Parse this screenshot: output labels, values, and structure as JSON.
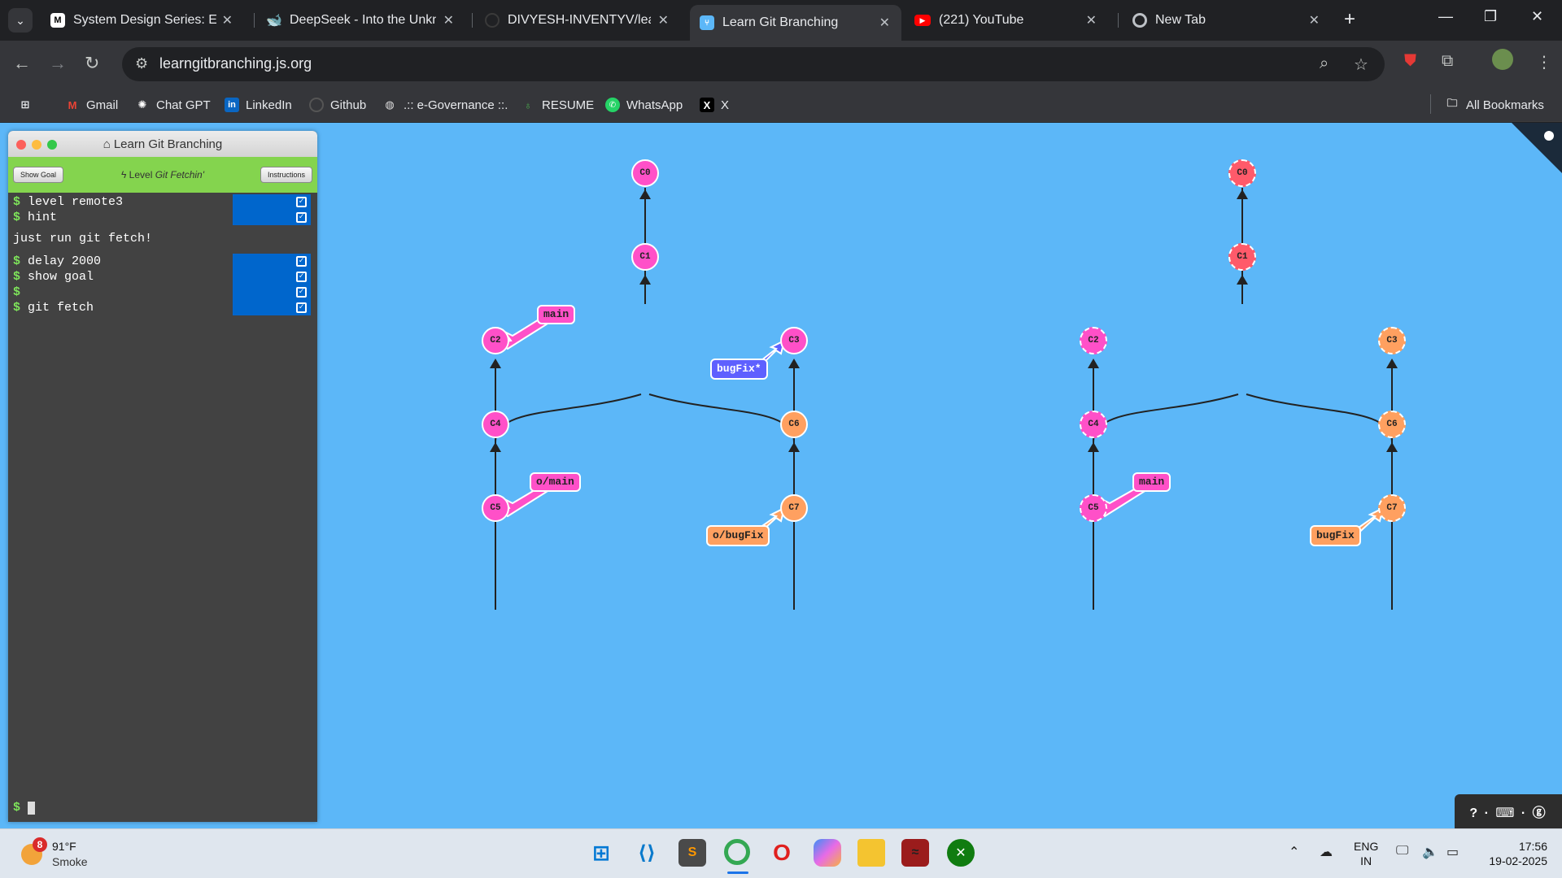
{
  "tabs": [
    {
      "favicon": "medium-icon",
      "title": "System Design Series: Elasti"
    },
    {
      "favicon": "deepseek-icon",
      "title": "DeepSeek - Into the Unkno"
    },
    {
      "favicon": "github-icon",
      "title": "DIVYESH-INVENTYV/learn-"
    },
    {
      "favicon": "learngit-icon",
      "title": "Learn Git Branching"
    },
    {
      "favicon": "youtube-icon",
      "title": "(221) YouTube"
    },
    {
      "favicon": "chrome-icon",
      "title": "New Tab"
    }
  ],
  "active_tab": 3,
  "address_bar": {
    "url": "learngitbranching.js.org"
  },
  "bookmarks": [
    {
      "icon": "apps-grid-icon",
      "label": ""
    },
    {
      "icon": "gmail-icon",
      "label": "Gmail"
    },
    {
      "icon": "chatgpt-icon",
      "label": "Chat GPT"
    },
    {
      "icon": "linkedin-icon",
      "label": "LinkedIn"
    },
    {
      "icon": "github-icon",
      "label": "Github"
    },
    {
      "icon": "globe-icon",
      "label": ".:: e-Governance ::."
    },
    {
      "icon": "resume-icon",
      "label": "RESUME"
    },
    {
      "icon": "whatsapp-icon",
      "label": "WhatsApp"
    },
    {
      "icon": "x-icon",
      "label": "X"
    }
  ],
  "all_bookmarks_label": "All Bookmarks",
  "terminal": {
    "title": "Learn Git Branching",
    "show_goal": "Show Goal",
    "level_prefix": "Level",
    "level_name": "Git Fetchin'",
    "instructions": "Instructions",
    "commands": [
      {
        "text": "level remote3"
      },
      {
        "text": "hint"
      },
      {
        "text": "delay 2000"
      },
      {
        "text": "show goal"
      },
      {
        "text": ""
      },
      {
        "text": "git fetch"
      }
    ],
    "hint_output": "just run git fetch!",
    "prompt": "$"
  },
  "trees": {
    "left": {
      "commits": [
        "C0",
        "C1",
        "C2",
        "C4",
        "C5",
        "C3",
        "C6",
        "C7"
      ],
      "branches": [
        {
          "name": "main",
          "target": "C2"
        },
        {
          "name": "bugFix*",
          "target": "C3"
        },
        {
          "name": "o/main",
          "target": "C5"
        },
        {
          "name": "o/bugFix",
          "target": "C7"
        }
      ]
    },
    "right": {
      "commits": [
        "C0",
        "C1",
        "C2",
        "C4",
        "C5",
        "C3",
        "C6",
        "C7"
      ],
      "branches": [
        {
          "name": "main",
          "target": "C5"
        },
        {
          "name": "bugFix",
          "target": "C7"
        }
      ]
    }
  },
  "help_widget": {
    "text": "? · ⌨ · ⓖ"
  },
  "colors": {
    "canvas": "#5cb7f8",
    "pink": "#ff50c8",
    "orange": "#ffa060",
    "blue": "#5e60ff",
    "red": "#ff5a6a"
  },
  "taskbar": {
    "weather": {
      "badge": "8",
      "temp": "91°F",
      "condition": "Smoke"
    },
    "apps": [
      "windows-start-icon",
      "vscode-icon",
      "sublime-icon",
      "chrome-icon",
      "opera-icon",
      "copilot-icon",
      "file-explorer-icon",
      "kali-icon",
      "xbox-icon"
    ],
    "language": {
      "line1": "ENG",
      "line2": "IN"
    },
    "time": "17:56",
    "date": "19-02-2025"
  }
}
